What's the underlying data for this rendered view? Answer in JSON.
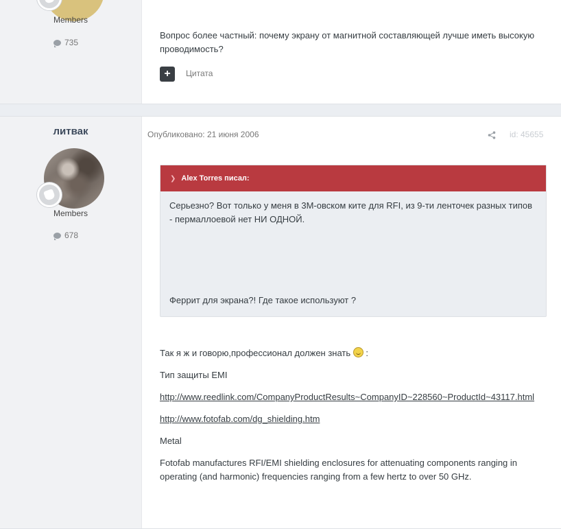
{
  "post1": {
    "group": "Members",
    "post_count": "735",
    "text": "Вопрос более частный: почему экрану от магнитной составляющей лучше иметь высокую проводимость?",
    "quote_label": "Цитата"
  },
  "post2": {
    "author": "литвак",
    "group": "Members",
    "post_count": "678",
    "published": "Опубликовано: 21 июня 2006",
    "post_id": "id: 45655",
    "quote": {
      "header": "Alex Torres писал:",
      "text1": "Серьезно? Вот только у меня в 3М-овском ките для RFI, из 9-ти ленточек разных типов - пермаллоевой нет НИ ОДНОЙ.",
      "text2": "Феррит для экрана?! Где такое используют ?"
    },
    "para1": "Так я ж и говорю,профессионал должен знать",
    "para1_end": " :",
    "para2": "Тип защиты EMI",
    "link1": "http://www.reedlink.com/CompanyProductResults~CompanyID~228560~ProductId~43117.html",
    "link2": "http://www.fotofab.com/dg_shielding.htm",
    "para3": "Metal",
    "para4": "Fotofab manufactures RFI/EMI shielding enclosures for attenuating components ranging in operating (and harmonic) frequencies ranging from a few hertz to over 50 GHz."
  },
  "icons": {
    "comment": "comment-bubble-icon",
    "share": "share-icon",
    "plus": "plus-icon",
    "chevron": "chevron-down-icon",
    "smiley": "smiley-icon"
  },
  "colors": {
    "quote_header": "#b93a40",
    "author_name": "#3d4a5c",
    "page_bg": "#ebeef2"
  }
}
